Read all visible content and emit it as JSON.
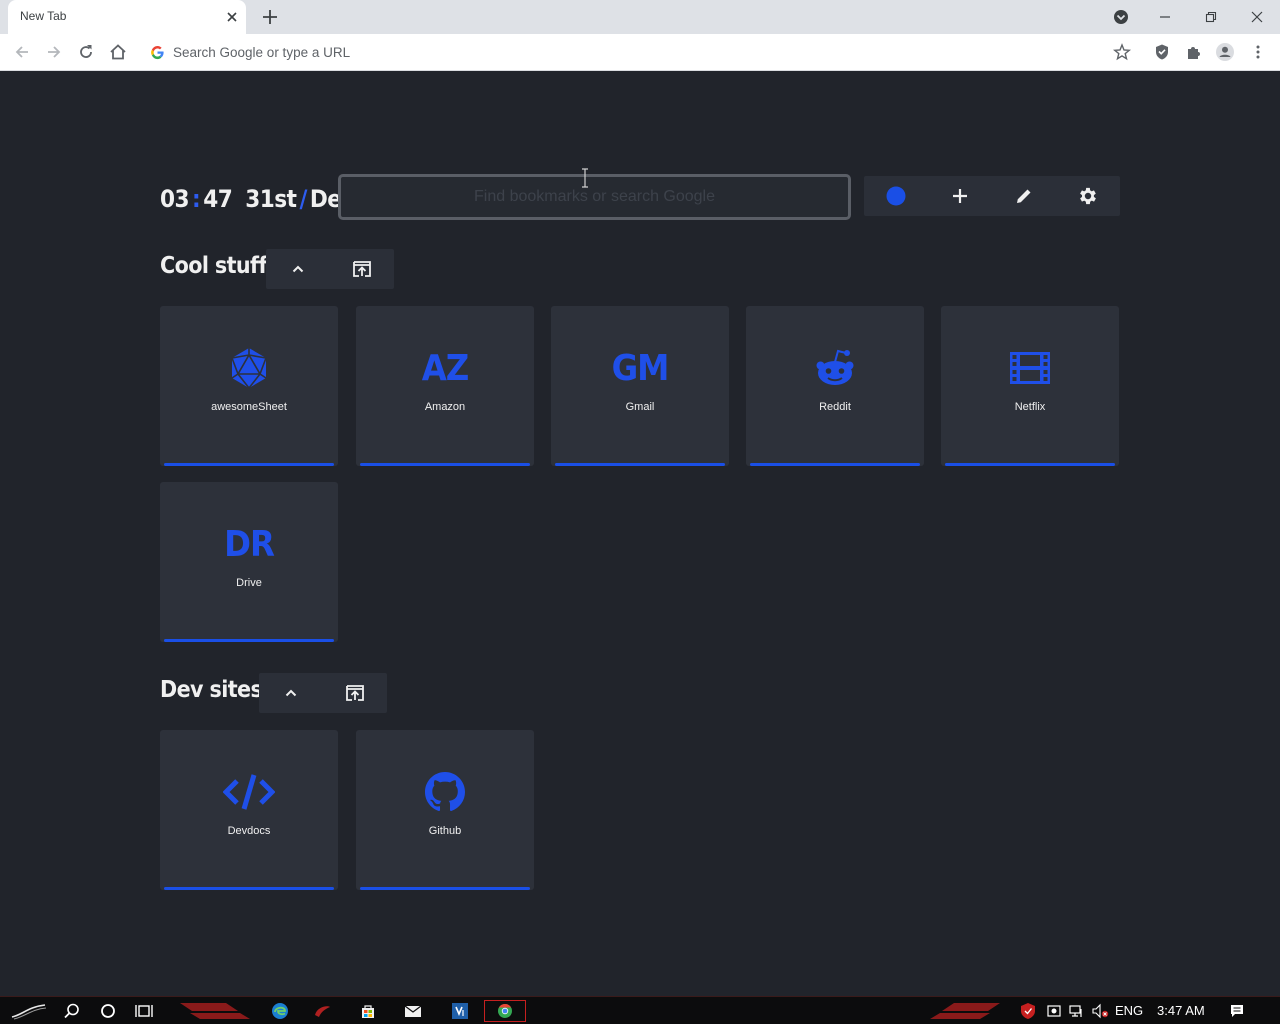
{
  "browser": {
    "tab_title": "New Tab",
    "omnibox_placeholder": "Search Google or type a URL"
  },
  "header": {
    "clock_hours": "03",
    "clock_sep": ":",
    "clock_minutes": "47",
    "date_day": "31st",
    "date_sep": "/",
    "date_month": "Dec",
    "search_placeholder": "Find bookmarks or search Google",
    "accent_color": "#1a4fe6"
  },
  "groups": [
    {
      "title": "Cool stuff",
      "tiles": [
        {
          "label": "awesomeSheet",
          "icon": "d20-dice-icon",
          "letters": ""
        },
        {
          "label": "Amazon",
          "icon": "",
          "letters": "AZ"
        },
        {
          "label": "Gmail",
          "icon": "",
          "letters": "GM"
        },
        {
          "label": "Reddit",
          "icon": "reddit-icon",
          "letters": ""
        },
        {
          "label": "Netflix",
          "icon": "film-icon",
          "letters": ""
        },
        {
          "label": "Drive",
          "icon": "",
          "letters": "DR"
        }
      ]
    },
    {
      "title": "Dev sites",
      "tiles": [
        {
          "label": "Devdocs",
          "icon": "code-icon",
          "letters": ""
        },
        {
          "label": "Github",
          "icon": "github-icon",
          "letters": ""
        }
      ]
    }
  ],
  "taskbar": {
    "language": "ENG",
    "time": "3:47 AM"
  }
}
